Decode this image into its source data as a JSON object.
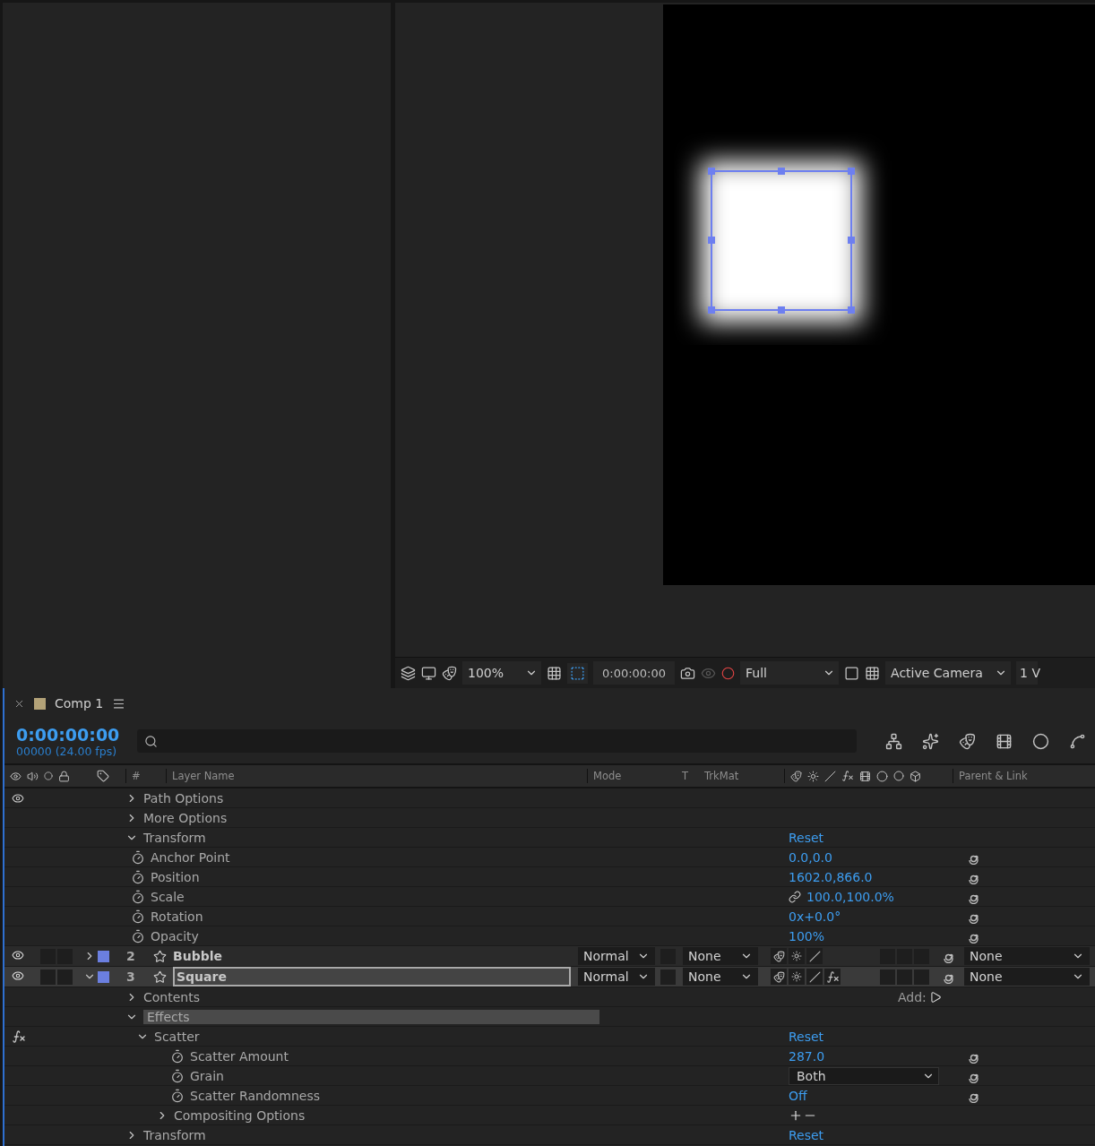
{
  "viewer": {
    "toolbar": {
      "zoom": "100%",
      "mask_toggle_on": true,
      "timecode": "0:00:00:00",
      "resolution": "Full",
      "camera": "Active Camera",
      "views": "1 V"
    }
  },
  "timeline": {
    "tab": {
      "title": "Comp 1",
      "color": "#b3a278"
    },
    "current_time": "0:00:00:00",
    "frame_info": "00000 (24.00 fps)",
    "columns": {
      "number": "#",
      "layer_name": "Layer Name",
      "mode": "Mode",
      "t": "T",
      "trkmat": "TrkMat",
      "parent": "Parent & Link"
    },
    "rows": [
      {
        "kind": "clipped",
        "children": [
          {
            "kind": "clipped",
            "children": [
              {
                "kind": "group",
                "label": "Path Options",
                "expanded": false,
                "visible": true
              },
              {
                "kind": "group",
                "label": "More Options",
                "expanded": false
              }
            ]
          },
          {
            "kind": "group",
            "label": "Transform",
            "expanded": true,
            "reset": "Reset",
            "children": [
              {
                "kind": "property",
                "label": "Anchor Point",
                "value": "0.0,0.0"
              },
              {
                "kind": "property",
                "label": "Position",
                "value": "1602.0,866.0"
              },
              {
                "kind": "property",
                "label": "Scale",
                "value": "100.0,100.0%",
                "linked": true
              },
              {
                "kind": "property",
                "label": "Rotation",
                "value": "0x+0.0°"
              },
              {
                "kind": "property",
                "label": "Opacity",
                "value": "100%"
              }
            ]
          }
        ]
      },
      {
        "kind": "layer",
        "number": "2",
        "name": "Bubble",
        "color": "#6b7fe0",
        "visible": true,
        "expanded": false,
        "selected": false,
        "mode": "Normal",
        "trkmat": "None",
        "parent": "None",
        "effects_switch": false
      },
      {
        "kind": "layer",
        "number": "3",
        "name": "Square",
        "color": "#6b7fe0",
        "visible": true,
        "expanded": true,
        "selected": true,
        "mode": "Normal",
        "trkmat": "None",
        "parent": "None",
        "effects_switch": true,
        "children": [
          {
            "kind": "group",
            "label": "Contents",
            "expanded": false,
            "add": "Add:"
          },
          {
            "kind": "group",
            "label": "Effects",
            "expanded": true,
            "selected": true,
            "children": [
              {
                "kind": "group",
                "label": "Scatter",
                "expanded": true,
                "effect": true,
                "reset": "Reset",
                "children": [
                  {
                    "kind": "property",
                    "label": "Scatter Amount",
                    "value": "287.0"
                  },
                  {
                    "kind": "choice",
                    "label": "Grain",
                    "value": "Both"
                  },
                  {
                    "kind": "property",
                    "label": "Scatter Randomness",
                    "value": "Off"
                  },
                  {
                    "kind": "group",
                    "label": "Compositing Options",
                    "expanded": false,
                    "mask_buttons": true
                  }
                ]
              }
            ]
          },
          {
            "kind": "group",
            "label": "Transform",
            "expanded": false,
            "reset": "Reset"
          }
        ]
      }
    ]
  }
}
